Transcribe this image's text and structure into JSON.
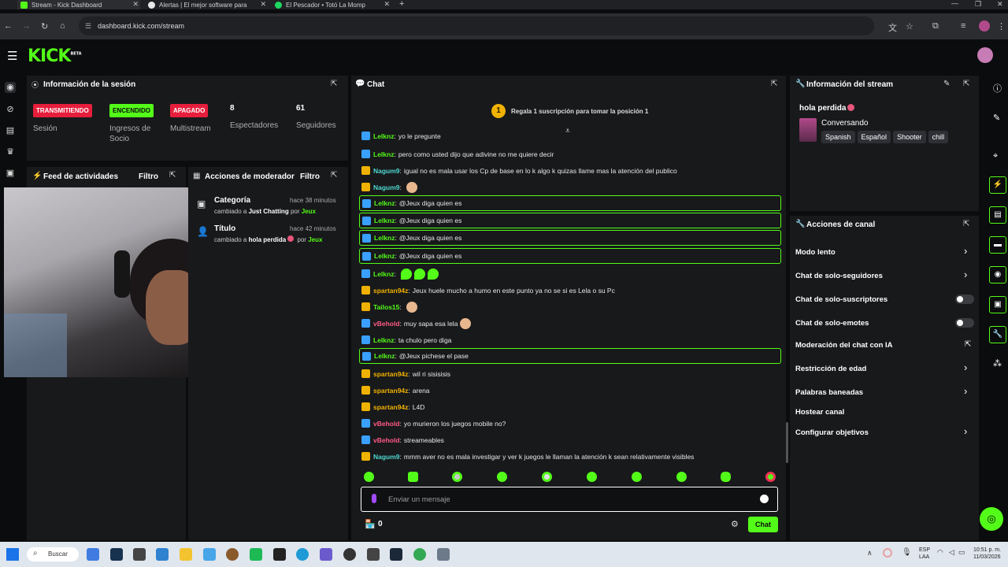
{
  "tabs": [
    {
      "title": "Stream - Kick Dashboard",
      "color": "#53fc18"
    },
    {
      "title": "Alertas | El mejor software para",
      "color": "#e9e9e9"
    },
    {
      "title": "El Pescador • Totó La Momp",
      "color": "#1ed760"
    }
  ],
  "browser": {
    "url": "dashboard.kick.com/stream"
  },
  "site": {
    "logo": "KICK",
    "beta": "BETA"
  },
  "session": {
    "title": "Información de la sesión",
    "badges": [
      {
        "label": "TRANSMITIENDO",
        "sub": "Sesión",
        "color": "#e61e3c"
      },
      {
        "label": "ENCENDIDO",
        "sub": "Ingresos de Socio",
        "color": "#53fc18"
      },
      {
        "label": "APAGADO",
        "sub": "Multistream",
        "color": "#e61e3c"
      }
    ],
    "stats": [
      {
        "value": "8",
        "label": "Espectadores"
      },
      {
        "value": "61",
        "label": "Seguidores"
      }
    ]
  },
  "feed": {
    "title": "Feed de actividades",
    "filter": "Filtro"
  },
  "mod": {
    "title": "Acciones de moderador",
    "filter": "Filtro",
    "items": [
      {
        "title": "Categoría",
        "time": "hace 38 minutos",
        "prefix": "cambiado a",
        "value": "Just Chatting",
        "by": "por",
        "user": "Jeux"
      },
      {
        "title": "Título",
        "time": "hace 42 minutos",
        "prefix": "cambiado a",
        "value": "hola perdida",
        "by": "por",
        "user": "Jeux"
      }
    ]
  },
  "chat": {
    "title": "Chat",
    "gift_rank": "1",
    "gift_text": "Regala 1 suscripción para tomar la posición 1",
    "messages": [
      {
        "user": "Lelknz",
        "text": "yo le pregunte",
        "badge": "b",
        "uc": "g",
        "hl": false
      },
      {
        "user": "Lelknz",
        "text": "pero como usted dijo que adivine no me quiere decir",
        "badge": "b",
        "uc": "g",
        "hl": false
      },
      {
        "user": "Nagum9",
        "text": "igual no es mala usar los Cp de base en lo k algo k quizas llame mas la atención del publico",
        "badge": "y",
        "uc": "t",
        "hl": false
      },
      {
        "user": "Nagum9",
        "text": "",
        "badge": "y",
        "uc": "t",
        "hl": false,
        "emotes": 1
      },
      {
        "user": "Lelknz",
        "text": "@Jeux diga quien es",
        "badge": "b",
        "uc": "g",
        "hl": true
      },
      {
        "user": "Lelknz",
        "text": "@Jeux diga quien es",
        "badge": "b",
        "uc": "g",
        "hl": true
      },
      {
        "user": "Lelknz",
        "text": "@Jeux diga quien es",
        "badge": "b",
        "uc": "g",
        "hl": true
      },
      {
        "user": "Lelknz",
        "text": "@Jeux diga quien es",
        "badge": "b",
        "uc": "g",
        "hl": true
      },
      {
        "user": "Lelknz",
        "text": "",
        "badge": "b",
        "uc": "g",
        "hl": false,
        "emotes": 3
      },
      {
        "user": "spartan94z",
        "text": "Jeux huele mucho a humo en este punto ya no se si es Lela o su Pc",
        "badge": "y",
        "uc": "o",
        "hl": false
      },
      {
        "user": "Tailos15",
        "text": "",
        "badge": "y",
        "uc": "g",
        "hl": false,
        "emotes": 1
      },
      {
        "user": "vBehold",
        "text": "muy sapa esa lela",
        "badge": "b",
        "uc": "p",
        "hl": false,
        "emotes": 1
      },
      {
        "user": "Lelknz",
        "text": "ta chulo pero diga",
        "badge": "b",
        "uc": "g",
        "hl": false
      },
      {
        "user": "Lelknz",
        "text": "@Jeux pichese el pase",
        "badge": "b",
        "uc": "g",
        "hl": true
      },
      {
        "user": "spartan94z",
        "text": "wil ri sisisisis",
        "badge": "y",
        "uc": "o",
        "hl": false
      },
      {
        "user": "spartan94z",
        "text": "arena",
        "badge": "y",
        "uc": "o",
        "hl": false
      },
      {
        "user": "spartan94z",
        "text": "L4D",
        "badge": "y",
        "uc": "o",
        "hl": false
      },
      {
        "user": "vBehold",
        "text": "yo murieron los juegos mobile no?",
        "badge": "b",
        "uc": "p",
        "hl": false
      },
      {
        "user": "vBehold",
        "text": "streameables",
        "badge": "b",
        "uc": "p",
        "hl": false
      },
      {
        "user": "Nagum9",
        "text": "mmm aver no es mala investigar y ver k juegos le llaman la atención k sean relativamente visibles",
        "badge": "y",
        "uc": "t",
        "hl": false
      }
    ],
    "input_placeholder": "Enviar un mensaje",
    "points": "0",
    "send_label": "Chat"
  },
  "stream_info": {
    "title": "Información del stream",
    "stream_title": "hola perdida",
    "category": "Conversando",
    "tags": [
      "Spanish",
      "Español",
      "Shooter",
      "chill"
    ]
  },
  "channel_actions": {
    "title": "Acciones de canal",
    "items": [
      {
        "label": "Modo lento",
        "kind": "chevron"
      },
      {
        "label": "Chat de solo-seguidores",
        "kind": "chevron"
      },
      {
        "label": "Chat de solo-suscriptores",
        "kind": "toggle"
      },
      {
        "label": "Chat de solo-emotes",
        "kind": "toggle"
      },
      {
        "label": "Moderación del chat con IA",
        "kind": "external"
      },
      {
        "label": "Restricción de edad",
        "kind": "chevron"
      },
      {
        "label": "Palabras baneadas",
        "kind": "chevron"
      },
      {
        "label": "Hostear canal",
        "kind": "none"
      },
      {
        "label": "Configurar objetivos",
        "kind": "chevron"
      }
    ]
  },
  "taskbar": {
    "search": "Buscar",
    "lang1": "ESP",
    "lang2": "LAA",
    "time": "10:51 p. m.",
    "date": "11/03/2026"
  },
  "colors": {
    "accent": "#53fc18",
    "panel": "#18191b",
    "live": "#e61e3c"
  }
}
